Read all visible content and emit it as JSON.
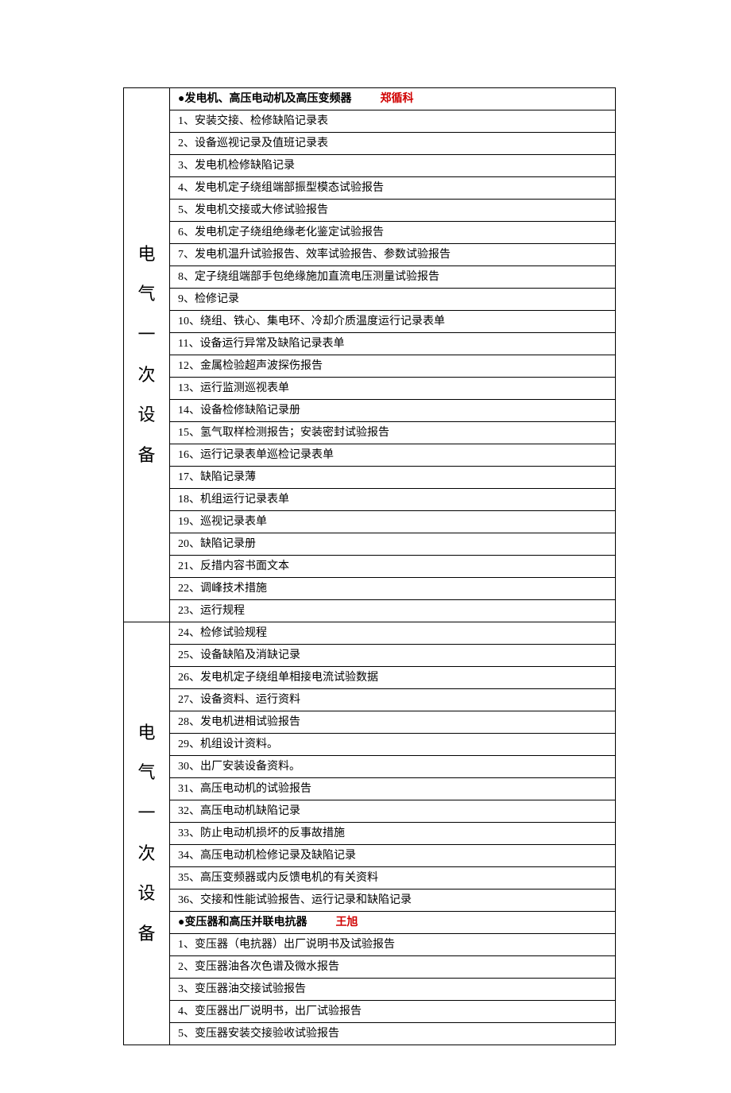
{
  "vertical_label": [
    "电",
    "气",
    "一",
    "次",
    "设",
    "备"
  ],
  "section1": {
    "title_prefix": "●发电机、高压电动机及高压变频器",
    "title_suffix": "郑循科",
    "rows": [
      "1、安装交接、检修缺陷记录表",
      "2、设备巡视记录及值班记录表",
      "3、发电机检修缺陷记录",
      "4、发电机定子绕组端部振型模态试验报告",
      "5、发电机交接或大修试验报告",
      "6、发电机定子绕组绝缘老化鉴定试验报告",
      "7、发电机温升试验报告、效率试验报告、参数试验报告",
      "8、定子绕组端部手包绝缘施加直流电压测量试验报告",
      "9、检修记录",
      "10、绕组、铁心、集电环、冷却介质温度运行记录表单",
      "11、设备运行异常及缺陷记录表单",
      "12、金属检验超声波探伤报告",
      "13、运行监测巡视表单",
      "14、设备检修缺陷记录册",
      "15、氢气取样检测报告；安装密封试验报告",
      "16、运行记录表单巡检记录表单",
      "17、缺陷记录薄",
      "18、机组运行记录表单",
      "19、巡视记录表单",
      "20、缺陷记录册",
      "21、反措内容书面文本",
      "22、调峰技术措施",
      "23、运行规程"
    ]
  },
  "section1b": {
    "rows": [
      "24、检修试验规程",
      "25、设备缺陷及消缺记录",
      "26、发电机定子绕组单相接电流试验数据",
      "27、设备资料、运行资料",
      "28、发电机进相试验报告",
      "29、机组设计资料。",
      "30、出厂安装设备资料。",
      "31、高压电动机的试验报告",
      "32、高压电动机缺陷记录",
      "33、防止电动机损坏的反事故措施",
      "34、高压电动机检修记录及缺陷记录",
      "35、高压变频器或内反馈电机的有关资料",
      "36、交接和性能试验报告、运行记录和缺陷记录"
    ]
  },
  "section2": {
    "title_prefix": "●变压器和高压并联电抗器",
    "title_suffix": "王旭",
    "rows": [
      "1、变压器（电抗器）出厂说明书及试验报告",
      "2、变压器油各次色谱及微水报告",
      "3、变压器油交接试验报告",
      "4、变压器出厂说明书，出厂试验报告",
      "5、变压器安装交接验收试验报告"
    ]
  }
}
